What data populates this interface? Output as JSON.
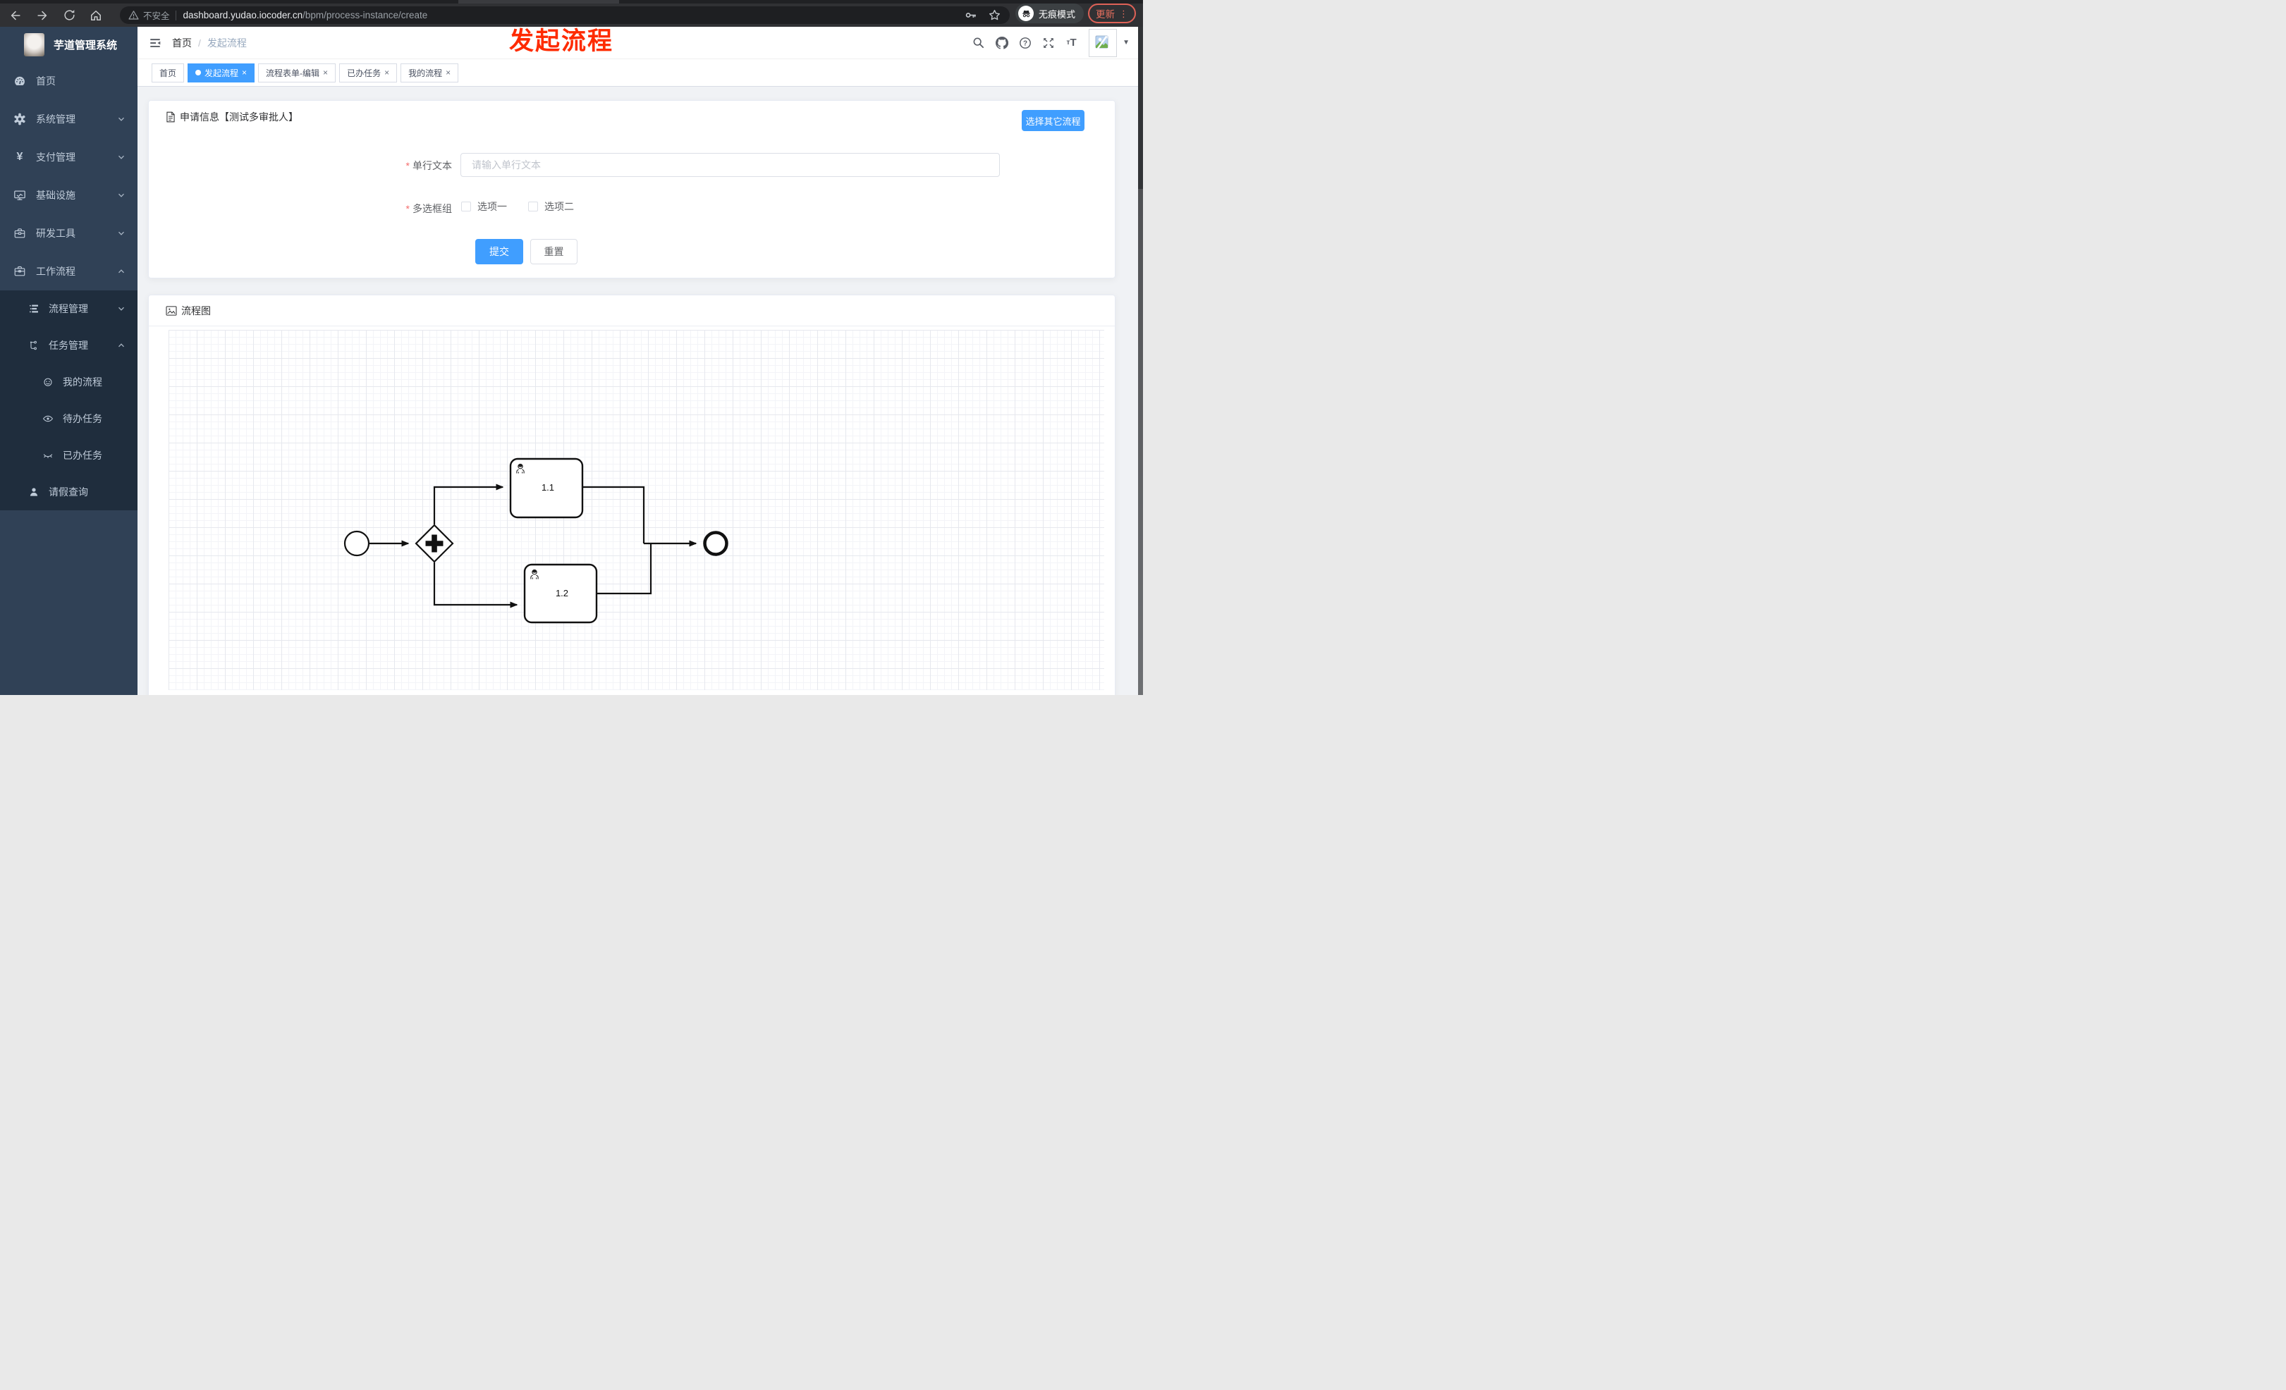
{
  "colors": {
    "accent": "#409eff",
    "sidebar_bg": "#304156",
    "submenu_bg": "#1f2d3d",
    "annotation_red": "#fe2b00",
    "update_pill": "#e8705f"
  },
  "browser": {
    "security_label": "不安全",
    "url_host": "dashboard.yudao.iocoder.cn",
    "url_path": "/bpm/process-instance/create",
    "incognito_label": "无痕模式",
    "update_label": "更新",
    "menu_dots": "⋮"
  },
  "annotation": {
    "text": "发起流程"
  },
  "app": {
    "title": "芋道管理系统"
  },
  "header": {
    "breadcrumb": {
      "home": "首页",
      "separator": "/",
      "current": "发起流程"
    },
    "font_icon_small": "т",
    "font_icon_big": "T",
    "caret": "▼"
  },
  "tabs": [
    {
      "label": "首页",
      "active": false,
      "closable": false
    },
    {
      "label": "发起流程",
      "active": true,
      "closable": true
    },
    {
      "label": "流程表单-编辑",
      "active": false,
      "closable": true
    },
    {
      "label": "已办任务",
      "active": false,
      "closable": true
    },
    {
      "label": "我的流程",
      "active": false,
      "closable": true
    }
  ],
  "close_glyph": "×",
  "sidebar": {
    "items": [
      {
        "label": "首页",
        "icon": "dashboard-icon",
        "state": "none"
      },
      {
        "label": "系统管理",
        "icon": "gear-icon",
        "state": "collapsed"
      },
      {
        "label": "支付管理",
        "icon": "yen-icon",
        "state": "collapsed",
        "yen": "¥"
      },
      {
        "label": "基础设施",
        "icon": "monitor-icon",
        "state": "collapsed"
      },
      {
        "label": "研发工具",
        "icon": "toolbox-icon",
        "state": "collapsed"
      },
      {
        "label": "工作流程",
        "icon": "briefcase-icon",
        "state": "expanded"
      }
    ],
    "submenu": [
      {
        "label": "流程管理",
        "icon": "list-icon",
        "state": "collapsed",
        "level": 1
      },
      {
        "label": "任务管理",
        "icon": "tree-icon",
        "state": "expanded",
        "level": 1
      },
      {
        "label": "我的流程",
        "icon": "face-icon",
        "level": 2
      },
      {
        "label": "待办任务",
        "icon": "eye-icon",
        "level": 2
      },
      {
        "label": "已办任务",
        "icon": "eye-closed-icon",
        "level": 2
      },
      {
        "label": "请假查询",
        "icon": "user-icon",
        "level": 1
      }
    ]
  },
  "form_card": {
    "title": "申请信息【测试多审批人】",
    "choose_other_button": "选择其它流程",
    "fields": [
      {
        "label": "单行文本",
        "required": true,
        "type": "text",
        "value": "",
        "placeholder": "请输入单行文本"
      },
      {
        "label": "多选框组",
        "required": true,
        "type": "checkbox-group",
        "options": [
          {
            "label": "选项一",
            "checked": false
          },
          {
            "label": "选项二",
            "checked": false
          }
        ]
      }
    ],
    "submit_label": "提交",
    "reset_label": "重置"
  },
  "diagram_card": {
    "title": "流程图",
    "bpmn": {
      "elements": [
        "start-event",
        "parallel-gateway",
        "user-task",
        "user-task",
        "end-event"
      ],
      "task_labels": [
        "1.1",
        "1.2"
      ],
      "flows": [
        "start→gateway",
        "gateway→1.1",
        "gateway→1.2",
        "1.1→end",
        "1.2→end"
      ]
    }
  }
}
